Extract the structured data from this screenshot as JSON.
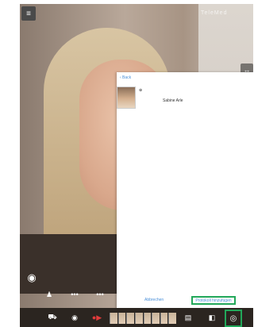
{
  "dialog": {
    "back_label": "‹ Back",
    "marker": "⊕",
    "person_name": "Sabine Arle",
    "cancel_label": "Abbrechen",
    "confirm_label": "Protokoll hinzufügen"
  },
  "overlay": {
    "menu_icon": "≡",
    "logo_text": "TeleMed",
    "side_badge_icon": "↔",
    "eye_icon": "◉"
  },
  "toolbar": {
    "upper_icons": [
      "♟",
      "•••",
      "•••"
    ],
    "bottom_icons": [
      "⛟",
      "◉",
      "●▶",
      "▤",
      "◧"
    ],
    "capture_icon": "◎",
    "accent_color": "#22a85a"
  }
}
